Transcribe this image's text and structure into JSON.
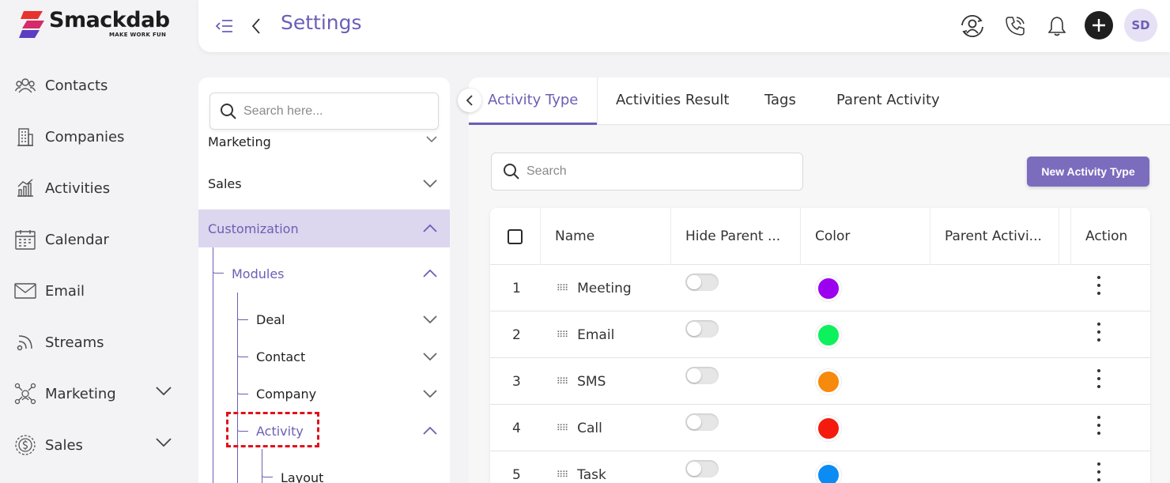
{
  "brand": {
    "name": "Smackdab",
    "tagline": "MAKE WORK FUN"
  },
  "nav": {
    "items": [
      {
        "label": "Contacts",
        "icon": "contacts-icon"
      },
      {
        "label": "Companies",
        "icon": "companies-icon"
      },
      {
        "label": "Activities",
        "icon": "activities-icon"
      },
      {
        "label": "Calendar",
        "icon": "calendar-icon"
      },
      {
        "label": "Email",
        "icon": "email-icon"
      },
      {
        "label": "Streams",
        "icon": "streams-icon"
      },
      {
        "label": "Marketing",
        "icon": "marketing-icon"
      },
      {
        "label": "Sales",
        "icon": "sales-icon"
      }
    ]
  },
  "header": {
    "title": "Settings",
    "avatar_initials": "SD"
  },
  "tree": {
    "search_placeholder": "Search here...",
    "items": {
      "marketing": "Marketing",
      "sales": "Sales",
      "customization": "Customization",
      "modules": "Modules",
      "deal": "Deal",
      "contact": "Contact",
      "company": "Company",
      "activity": "Activity",
      "layout": "Layout"
    }
  },
  "tabs": [
    "Activity Type",
    "Activities Result",
    "Tags",
    "Parent Activity"
  ],
  "toolbar": {
    "search_placeholder": "Search",
    "new_button": "New Activity Type"
  },
  "table": {
    "columns": [
      "Name",
      "Hide Parent ...",
      "Color",
      "Parent Activi...",
      "Action"
    ],
    "rows": [
      {
        "index": "1",
        "name": "Meeting",
        "color": "#9b00ef"
      },
      {
        "index": "2",
        "name": "Email",
        "color": "#0df15c"
      },
      {
        "index": "3",
        "name": "SMS",
        "color": "#f7890c"
      },
      {
        "index": "4",
        "name": "Call",
        "color": "#f51a0e"
      },
      {
        "index": "5",
        "name": "Task",
        "color": "#0b8cf4"
      }
    ]
  },
  "colors": {
    "accent": "#6b5fb5",
    "active_section_bg": "#dcd6ee",
    "primary_button": "#7b6cbe",
    "annotation": "#e0111b"
  }
}
